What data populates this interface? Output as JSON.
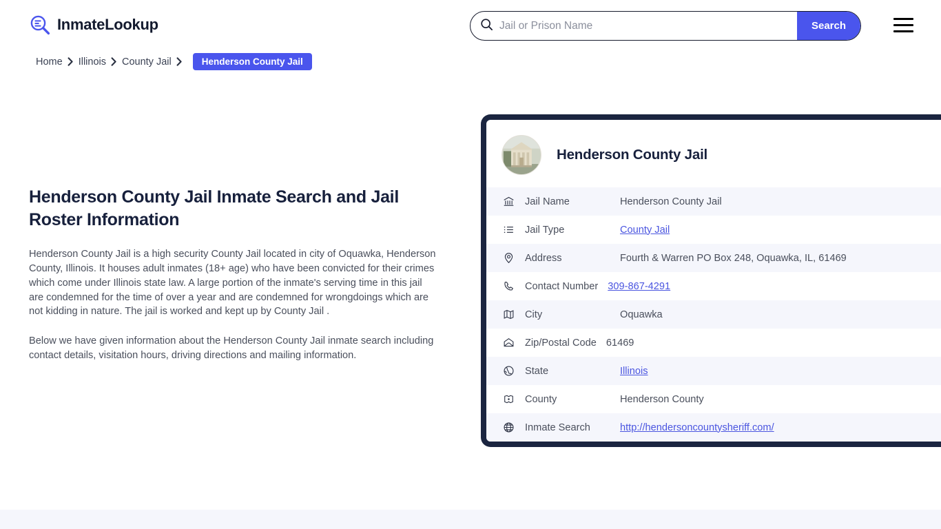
{
  "brand": {
    "name": "InmateLookup",
    "logo_icon": "magnifier-list-icon",
    "accent_color": "#4a55ed",
    "dark_color": "#1b2540"
  },
  "search": {
    "placeholder": "Jail or Prison Name",
    "value": "",
    "button_label": "Search",
    "icon": "search-icon"
  },
  "menu": {
    "icon": "hamburger-menu-icon"
  },
  "breadcrumb": {
    "items": [
      {
        "label": "Home"
      },
      {
        "label": "Illinois"
      },
      {
        "label": "County Jail"
      }
    ],
    "current": "Henderson County Jail",
    "separator": "❯"
  },
  "main": {
    "title": "Henderson County Jail Inmate Search and Jail Roster Information",
    "paragraph_1": "Henderson County Jail is a high security County Jail located in city of Oquawka, Henderson County, Illinois. It houses adult inmates (18+ age) who have been convicted for their crimes which come under Illinois state law. A large portion of the inmate's serving time in this jail are condemned for the time of over a year and are condemned for wrongdoings which are not kidding in nature. The jail is worked and kept up by County Jail .",
    "paragraph_2": "Below we have given information about the Henderson County Jail inmate search including contact details, visitation hours, driving directions and mailing information."
  },
  "card": {
    "avatar_icon": "courthouse-photo",
    "title": "Henderson County Jail",
    "rows": [
      {
        "icon": "bank-icon",
        "label": "Jail Name",
        "value": "Henderson County Jail",
        "link": false
      },
      {
        "icon": "list-icon",
        "label": "Jail Type",
        "value": "County Jail",
        "link": true
      },
      {
        "icon": "map-pin-icon",
        "label": "Address",
        "value": "Fourth & Warren PO Box 248, Oquawka, IL, 61469",
        "link": false
      },
      {
        "icon": "phone-icon",
        "label": "Contact Number",
        "value": "309-867-4291",
        "link": true
      },
      {
        "icon": "map-icon",
        "label": "City",
        "value": "Oquawka",
        "link": false
      },
      {
        "icon": "envelope-icon",
        "label": "Zip/Postal Code",
        "value": "61469",
        "link": false
      },
      {
        "icon": "globe-icon",
        "label": "State",
        "value": "Illinois",
        "link": true
      },
      {
        "icon": "badge-icon",
        "label": "County",
        "value": "Henderson County",
        "link": false
      },
      {
        "icon": "world-wide-web-icon",
        "label": "Inmate Search",
        "value": "http://hendersoncountysheriff.com/",
        "link": true
      }
    ]
  }
}
